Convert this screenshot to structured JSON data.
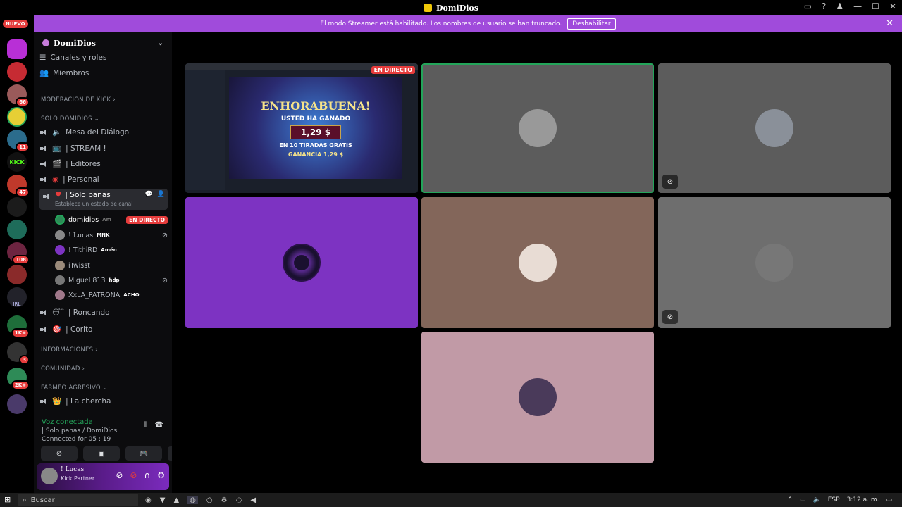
{
  "window": {
    "title": "DomiDios"
  },
  "banner": {
    "text": "El modo Streamer está habilitado. Los nombres de usuario se han truncado.",
    "button": "Deshabilitar"
  },
  "rail": {
    "nuevo": "NUEVO",
    "badges": [
      "66",
      "11",
      "47",
      "108",
      "1K+",
      "3",
      "2K+"
    ],
    "kick_label": "KICK",
    "irl_label": "IRL"
  },
  "guild": {
    "name": "DomiDios"
  },
  "sidebar": {
    "top_items": [
      "Canales y roles",
      "Miembros"
    ],
    "categories": {
      "moderacion": "MODERACION DE KICK",
      "solo_domidios": "SOLO DOMIDIOS",
      "informaciones": "INFORMACIONES",
      "comunidad": "COMUNIDAD",
      "farmeo": "FARMEO AGRESIVO"
    },
    "channels": {
      "mesa": "Mesa del Diálogo",
      "stream": "| STREAM !",
      "editores": "| Editores",
      "personal": "| Personal",
      "solo_panas": "| Solo panas",
      "solo_panas_status": "Establece un estado de canal",
      "roncando": "| Roncando",
      "corito": "| Corito",
      "chercha": "| La chercha"
    },
    "voice_users": [
      {
        "name": "domidios",
        "tag": "Am",
        "live": "EN DIRECTO"
      },
      {
        "name": "! Lucas",
        "tag": "MNK"
      },
      {
        "name": "! TithiRD",
        "tag": "Amén"
      },
      {
        "name": "iTwisst",
        "tag": ""
      },
      {
        "name": "Miguel 813",
        "tag": "hdp"
      },
      {
        "name": "XxLA_PATRONA",
        "tag": "ACHO"
      }
    ]
  },
  "voice_panel": {
    "status": "Voz conectada",
    "location": "| Solo panas / DomiDios",
    "time": "Connected for 05 : 19"
  },
  "user_panel": {
    "name": "! Lucas",
    "subtitle": "Kick Partner"
  },
  "stream": {
    "live": "EN DIRECTO",
    "headline": "ENHORABUENA!",
    "line1": "USTED HA GANADO",
    "amount": "1,29 $",
    "line2": "EN 10 TIRADAS GRATIS",
    "ganancia": "GANANCIA 1,29 $"
  },
  "taskbar": {
    "search": "Buscar",
    "lang": "ESP",
    "time": "3:12 a. m."
  },
  "colors": {
    "banner": "#a04bdb",
    "tile_purple": "#7d33c2",
    "tile_brown": "#83665a",
    "tile_pink": "#c19aa6",
    "tile_gray": "#5c5c5c"
  }
}
